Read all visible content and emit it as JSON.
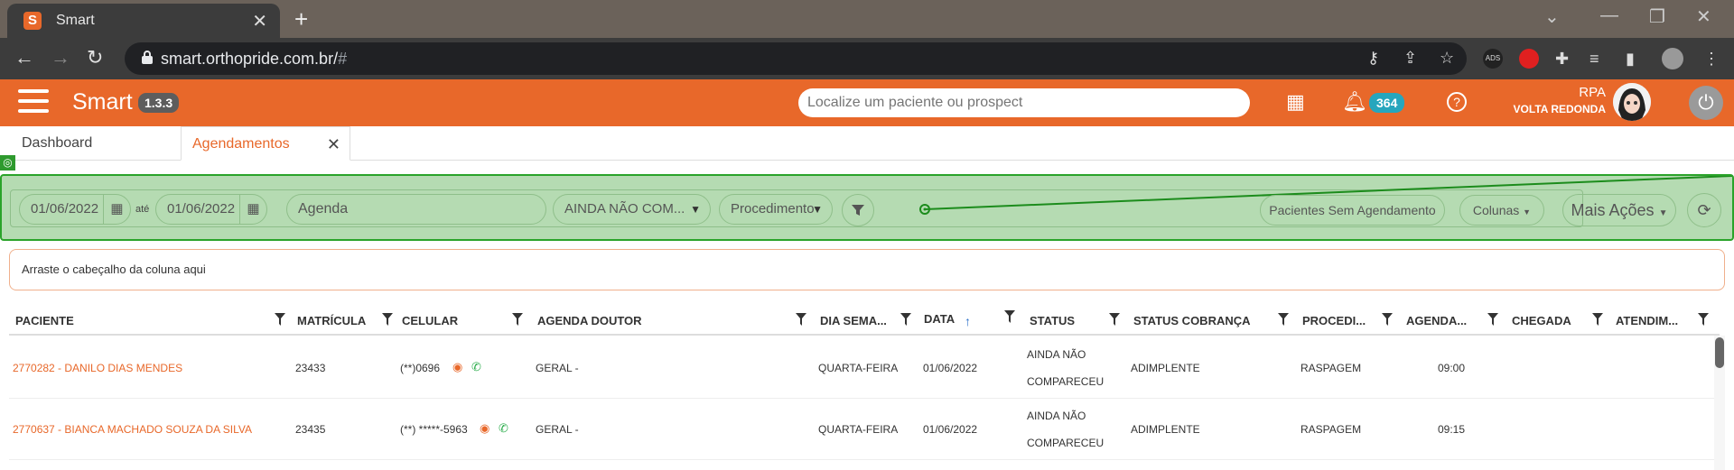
{
  "browser": {
    "tab_title": "Smart",
    "url_main": "smart.orthopride.com.br/",
    "url_hash": "#"
  },
  "header": {
    "brand": "Smart",
    "version": "1.3.3",
    "search_placeholder": "Localize um paciente ou prospect",
    "notif_count": "364",
    "user_name": "RPA",
    "user_unit": "VOLTA REDONDA"
  },
  "tabs": [
    {
      "label": "Dashboard"
    },
    {
      "label": "Agendamentos"
    }
  ],
  "filters": {
    "date_from": "01/06/2022",
    "until": "até",
    "date_to": "01/06/2022",
    "agenda": "Agenda",
    "status": "AINDA NÃO COM...",
    "procedure": "Procedimento",
    "no_schedule": "Pacientes Sem Agendamento",
    "columns": "Colunas",
    "more_actions": "Mais Ações"
  },
  "dropzone": "Arraste o cabeçalho da coluna aqui",
  "columns": [
    "PACIENTE",
    "MATRÍCULA",
    "CELULAR",
    "AGENDA DOUTOR",
    "DIA SEMA...",
    "DATA",
    "STATUS",
    "STATUS COBRANÇA",
    "PROCEDI...",
    "AGENDA...",
    "CHEGADA",
    "ATENDIM..."
  ],
  "rows": [
    {
      "paciente": "2770282 - DANILO DIAS MENDES",
      "matricula": "23433",
      "celular": "(**)0696",
      "agenda": "GERAL -",
      "dia": "QUARTA-FEIRA",
      "data": "01/06/2022",
      "status1": "AINDA NÃO",
      "status2": "COMPARECEU",
      "cobranca": "ADIMPLENTE",
      "proc": "RASPAGEM",
      "hora": "09:00"
    },
    {
      "paciente": "2770637 - BIANCA MACHADO SOUZA DA SILVA",
      "matricula": "23435",
      "celular": "(**) *****-5963",
      "agenda": "GERAL -",
      "dia": "QUARTA-FEIRA",
      "data": "01/06/2022",
      "status1": "AINDA NÃO",
      "status2": "COMPARECEU",
      "cobranca": "ADIMPLENTE",
      "proc": "RASPAGEM",
      "hora": "09:15"
    }
  ],
  "colors": {
    "brand": "#e8682a",
    "highlight": "#b5dbb2",
    "badge": "#26a6bd"
  }
}
